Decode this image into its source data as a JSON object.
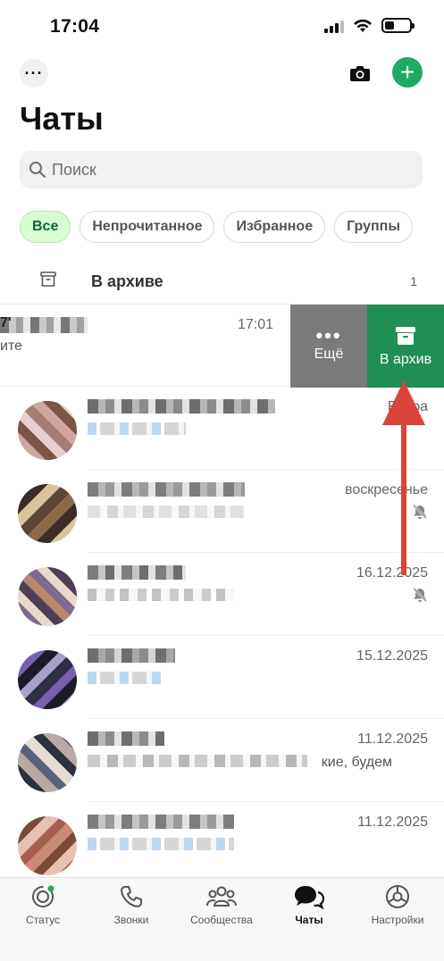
{
  "status_bar": {
    "time": "17:04"
  },
  "header": {
    "title": "Чаты"
  },
  "search": {
    "placeholder": "Поиск"
  },
  "filters": [
    {
      "label": "Все",
      "active": true
    },
    {
      "label": "Непрочитанное",
      "active": false
    },
    {
      "label": "Избранное",
      "active": false
    },
    {
      "label": "Группы",
      "active": false
    }
  ],
  "archived": {
    "label": "В архиве",
    "count": "1"
  },
  "swiped_chat": {
    "name_prefix": "7'",
    "snippet": "ите",
    "time": "17:01",
    "action_more": "Ещё",
    "action_archive": "В архив"
  },
  "chats": [
    {
      "time": "Вчера",
      "muted": false,
      "snippet": ""
    },
    {
      "time": "воскресенье",
      "muted": true,
      "snippet": ""
    },
    {
      "time": "16.12.2025",
      "muted": true,
      "snippet": ""
    },
    {
      "time": "15.12.2025",
      "muted": false,
      "snippet": ""
    },
    {
      "time": "11.12.2025",
      "muted": false,
      "snippet": "кие, будем"
    },
    {
      "time": "11.12.2025",
      "muted": false,
      "snippet": ""
    }
  ],
  "tabs": [
    {
      "label": "Статус",
      "icon": "status-icon",
      "active": false
    },
    {
      "label": "Звонки",
      "icon": "phone-icon",
      "active": false
    },
    {
      "label": "Сообщества",
      "icon": "communities-icon",
      "active": false
    },
    {
      "label": "Чаты",
      "icon": "chats-icon",
      "active": true
    },
    {
      "label": "Настройки",
      "icon": "settings-icon",
      "active": false
    }
  ],
  "colors": {
    "accent": "#1daa61",
    "archive_action": "#1f8f55",
    "more_action": "#7b7b7b",
    "annotation": "#d9443b"
  }
}
